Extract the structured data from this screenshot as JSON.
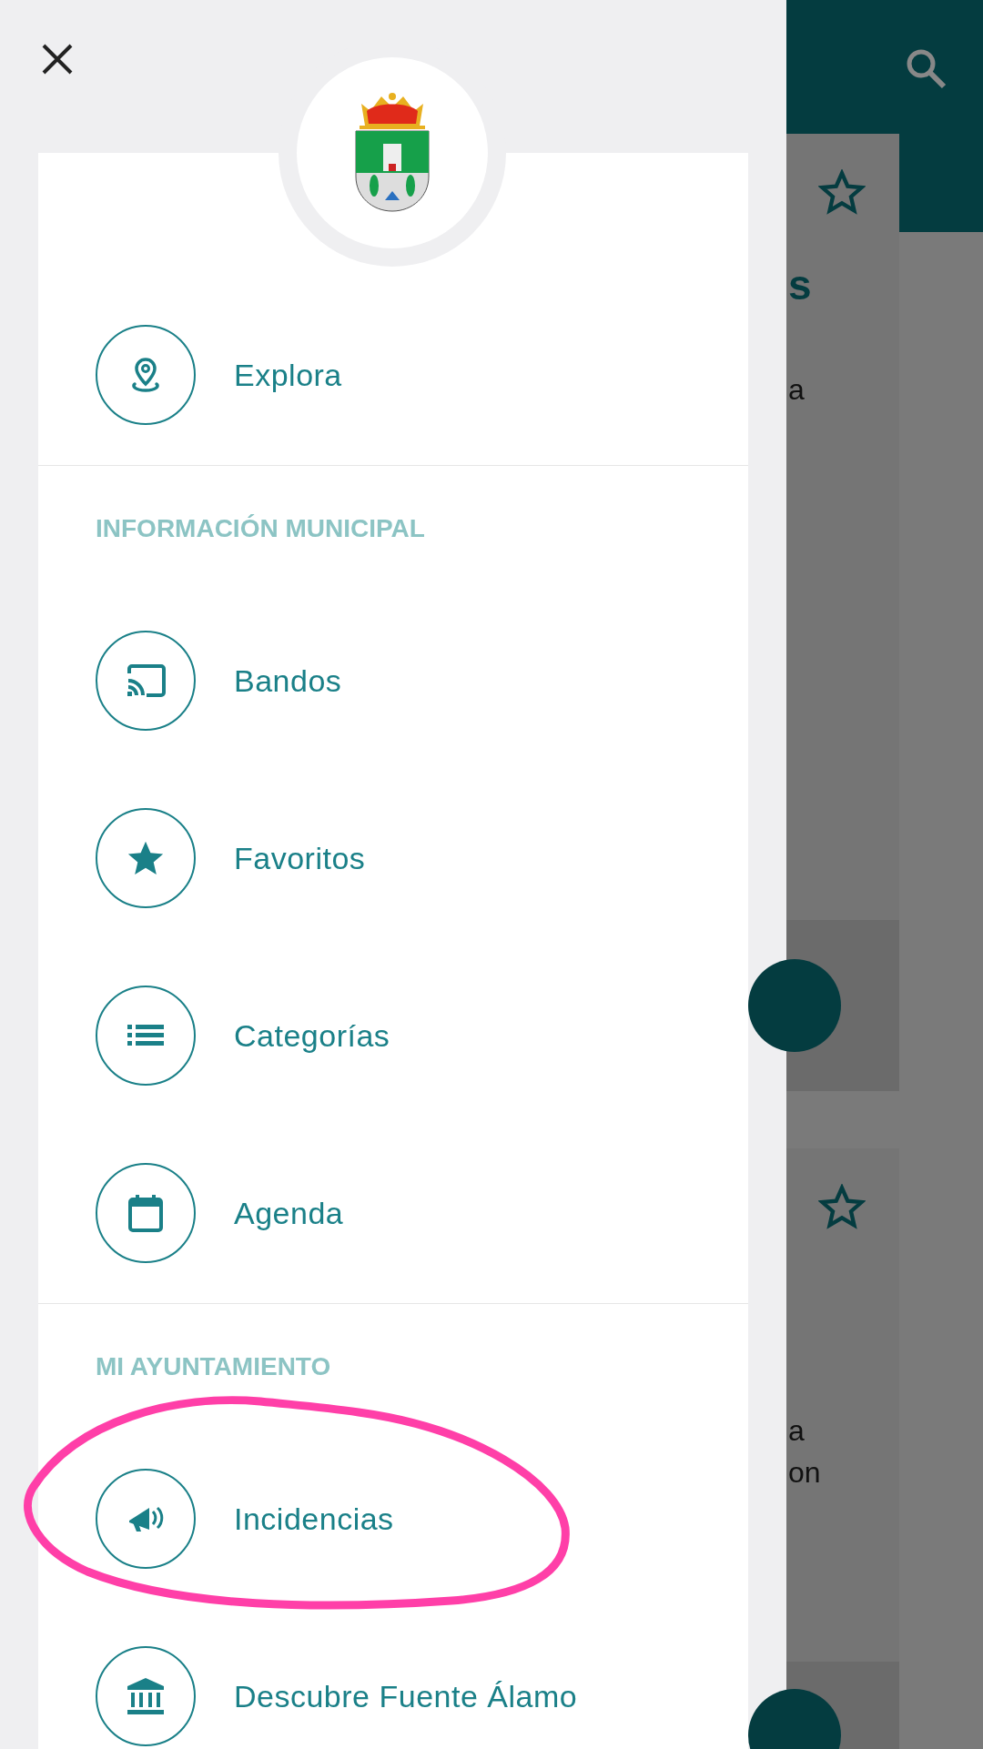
{
  "menu": {
    "top_items": [
      {
        "label": "Explora",
        "kind": "pin"
      }
    ],
    "sections": [
      {
        "title": "INFORMACIÓN MUNICIPAL",
        "items": [
          {
            "label": "Bandos",
            "kind": "cast"
          },
          {
            "label": "Favoritos",
            "kind": "star"
          },
          {
            "label": "Categorías",
            "kind": "list"
          },
          {
            "label": "Agenda",
            "kind": "calendar"
          }
        ]
      },
      {
        "title": "MI AYUNTAMIENTO",
        "items": [
          {
            "label": "Incidencias",
            "kind": "megaphone",
            "annotated": true
          },
          {
            "label": "Descubre Fuente Álamo",
            "kind": "bank"
          }
        ]
      }
    ]
  },
  "background": {
    "fragments": [
      {
        "text": "s",
        "kind": "title"
      },
      {
        "text": "a",
        "kind": "body"
      },
      {
        "text": "a",
        "kind": "body"
      },
      {
        "text": "on",
        "kind": "body"
      }
    ]
  }
}
